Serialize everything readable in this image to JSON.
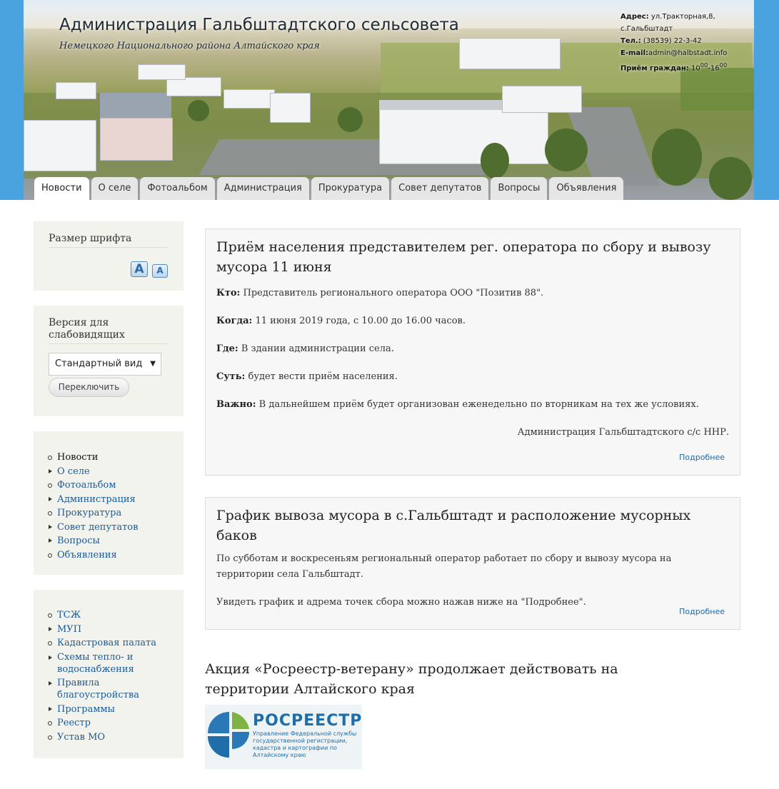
{
  "header": {
    "title": "Администрация Гальбштадтского сельсовета",
    "subtitle": "Немецкого Национального района Алтайского края",
    "contacts": {
      "address_label": "Адрес:",
      "address": "ул.Тракторная,8, с.Гальбштадт",
      "phone_label": "Тел.:",
      "phone": "(38539) 22-3-42",
      "email_label": "E-mail:",
      "email": "admin@halbstadt.info",
      "hours_label": "Приём граждан:",
      "hours_from": "10",
      "hours_from_sup": "00",
      "hours_sep": "-",
      "hours_to": "16",
      "hours_to_sup": "00"
    }
  },
  "tabs": [
    "Новости",
    "О селе",
    "Фотоальбом",
    "Администрация",
    "Прокуратура",
    "Совет депутатов",
    "Вопросы",
    "Объявления"
  ],
  "sidebar": {
    "font_block": {
      "title": "Размер шрифта",
      "increase": "A",
      "decrease": "A"
    },
    "vision_block": {
      "title": "Версия для слабовидящих",
      "select_value": "Стандартный вид",
      "button": "Переключить"
    },
    "menu": [
      "Новости",
      "О селе",
      "Фотоальбом",
      "Администрация",
      "Прокуратура",
      "Совет депутатов",
      "Вопросы",
      "Объявления"
    ],
    "links": [
      "ТСЖ",
      "МУП",
      "Кадастровая палата",
      "Схемы тепло- и водоснабжения",
      "Правила благоустройства",
      "Программы",
      "Реестр",
      "Устав МО"
    ]
  },
  "articles": [
    {
      "title": "Приём населения представителем рег. оператора по сбору и вывозу мусора 11 июня",
      "who_label": "Кто:",
      "who": " Представитель регионального оператора ООО \"Позитив 88\".",
      "when_label": "Когда:",
      "when": " 11 июня 2019 года, с 10.00 до 16.00 часов.",
      "where_label": "Где:",
      "where": " В здании администрации села.",
      "essence_label": "Суть:",
      "essence": " будет вести приём населения.",
      "important_label": "Важно:",
      "important": " В дальнейшем приём будет организован еженедельно по вторникам на тех же условиях.",
      "signature": "Администрация Гальбштадтского с/с ННР.",
      "more": "Подробнее"
    },
    {
      "title": "График вывоза мусора в с.Гальбштадт и расположение мусорных баков",
      "p1": "По субботам и воскресеньям региональный оператор работает по сбору и вывозу мусора на территории села Гальбштадт.",
      "p2": "Увидеть график и адрема точек сбора можно нажав ниже на \"Подробнее\".",
      "more": "Подробнее"
    },
    {
      "title": "Акция «Росреестр-ветерану» продолжает действовать на территории Алтайского края"
    }
  ],
  "logo": {
    "name": "РОСРЕЕСТР",
    "caption": "Управление Федеральной службы государственной регистрации, кадастра и картографии по Алтайскому краю"
  }
}
